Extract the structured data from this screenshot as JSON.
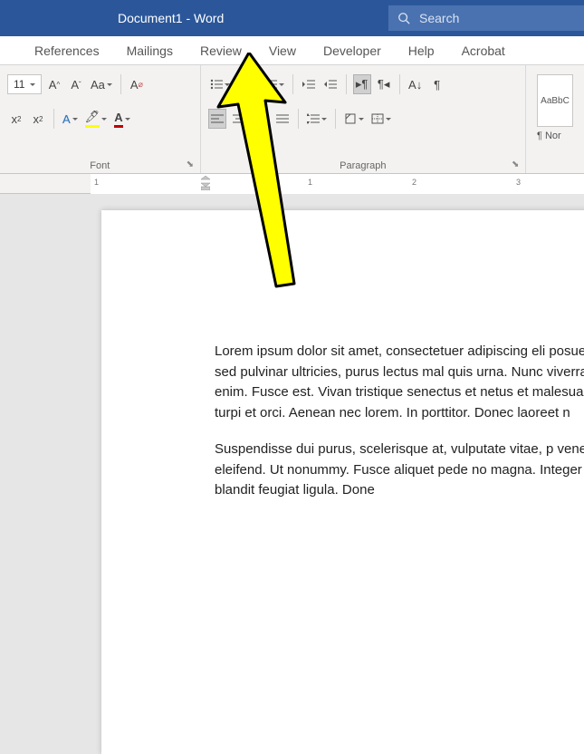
{
  "titlebar": {
    "title": "Document1  -  Word",
    "search_placeholder": "Search"
  },
  "tabs": [
    "References",
    "Mailings",
    "Review",
    "View",
    "Developer",
    "Help",
    "Acrobat"
  ],
  "ribbon": {
    "font": {
      "size": "11",
      "label": "Font"
    },
    "paragraph": {
      "label": "Paragraph"
    },
    "styles": {
      "box1": "AaBbC",
      "box2": "¶ Nor"
    }
  },
  "ruler": {
    "marks": [
      "1",
      "1",
      "2",
      "3"
    ]
  },
  "document": {
    "p1": "Lorem ipsum dolor sit amet, consectetuer adipiscing eli posuere, magna sed pulvinar ultricies, purus lectus mal quis urna. Nunc viverra imperdiet enim. Fusce est. Vivan tristique senectus et netus et malesuada fames ac turpi et orci. Aenean nec lorem. In porttitor. Donec laoreet n",
    "p2": "Suspendisse dui purus, scelerisque at, vulputate vitae, p venenatis eleifend. Ut nonummy. Fusce aliquet pede no magna. Integer nulla. Donec blandit feugiat ligula. Done"
  }
}
